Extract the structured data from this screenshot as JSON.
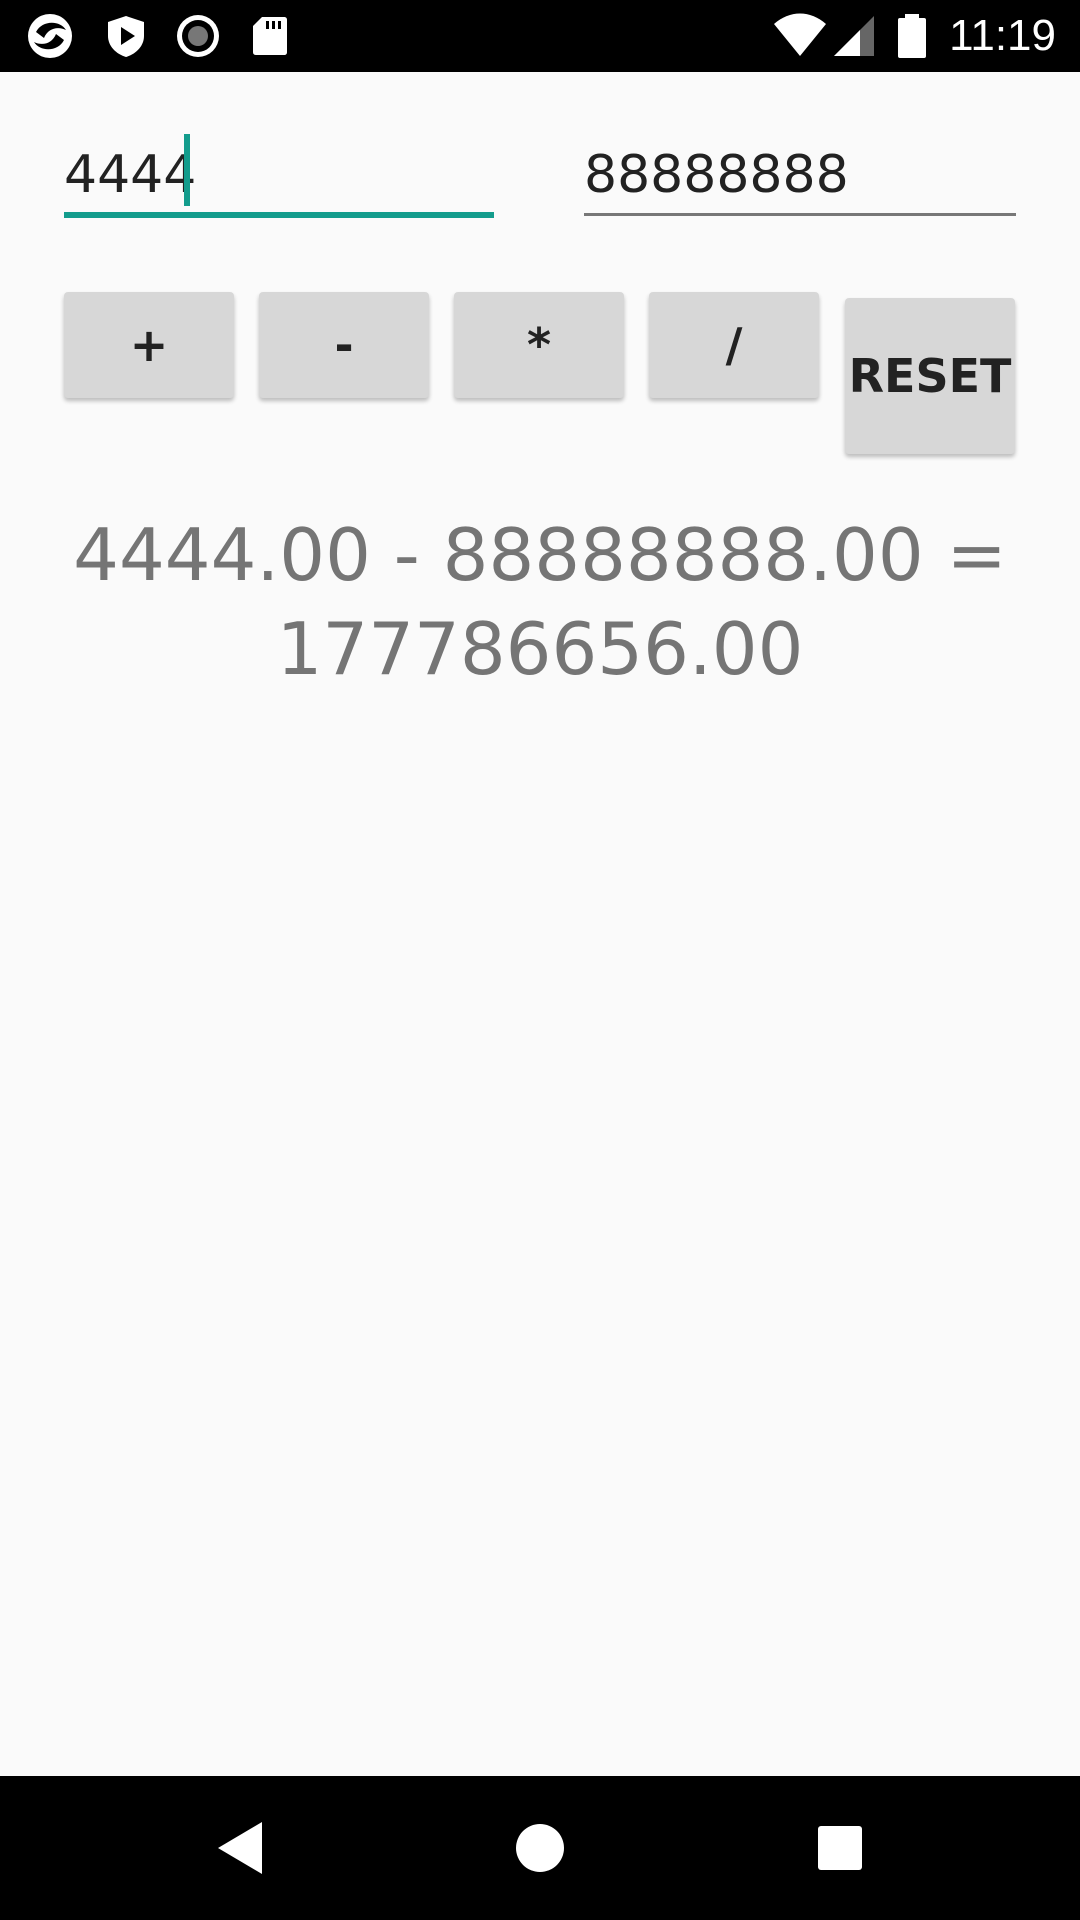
{
  "status_bar": {
    "time": "11:19",
    "left_icons": [
      "app-logo-icon",
      "shield-play-icon",
      "record-icon",
      "sd-card-icon"
    ],
    "right_icons": [
      "wifi-icon",
      "cellular-signal-icon",
      "battery-icon"
    ]
  },
  "inputs": {
    "first_value": "4444",
    "second_value": "88888888",
    "focused": "first"
  },
  "buttons": {
    "add": "+",
    "subtract": "-",
    "multiply": "*",
    "divide": "/",
    "reset": "RESET"
  },
  "result": {
    "text": "4444.00 - 88888888.00 = 177786656.00"
  },
  "nav_bar": {
    "icons": [
      "back-icon",
      "home-icon",
      "recents-icon"
    ]
  },
  "colors": {
    "accent": "#139c8c",
    "background": "#fafafa",
    "button": "#d7d7d7",
    "result_text": "#757575"
  }
}
